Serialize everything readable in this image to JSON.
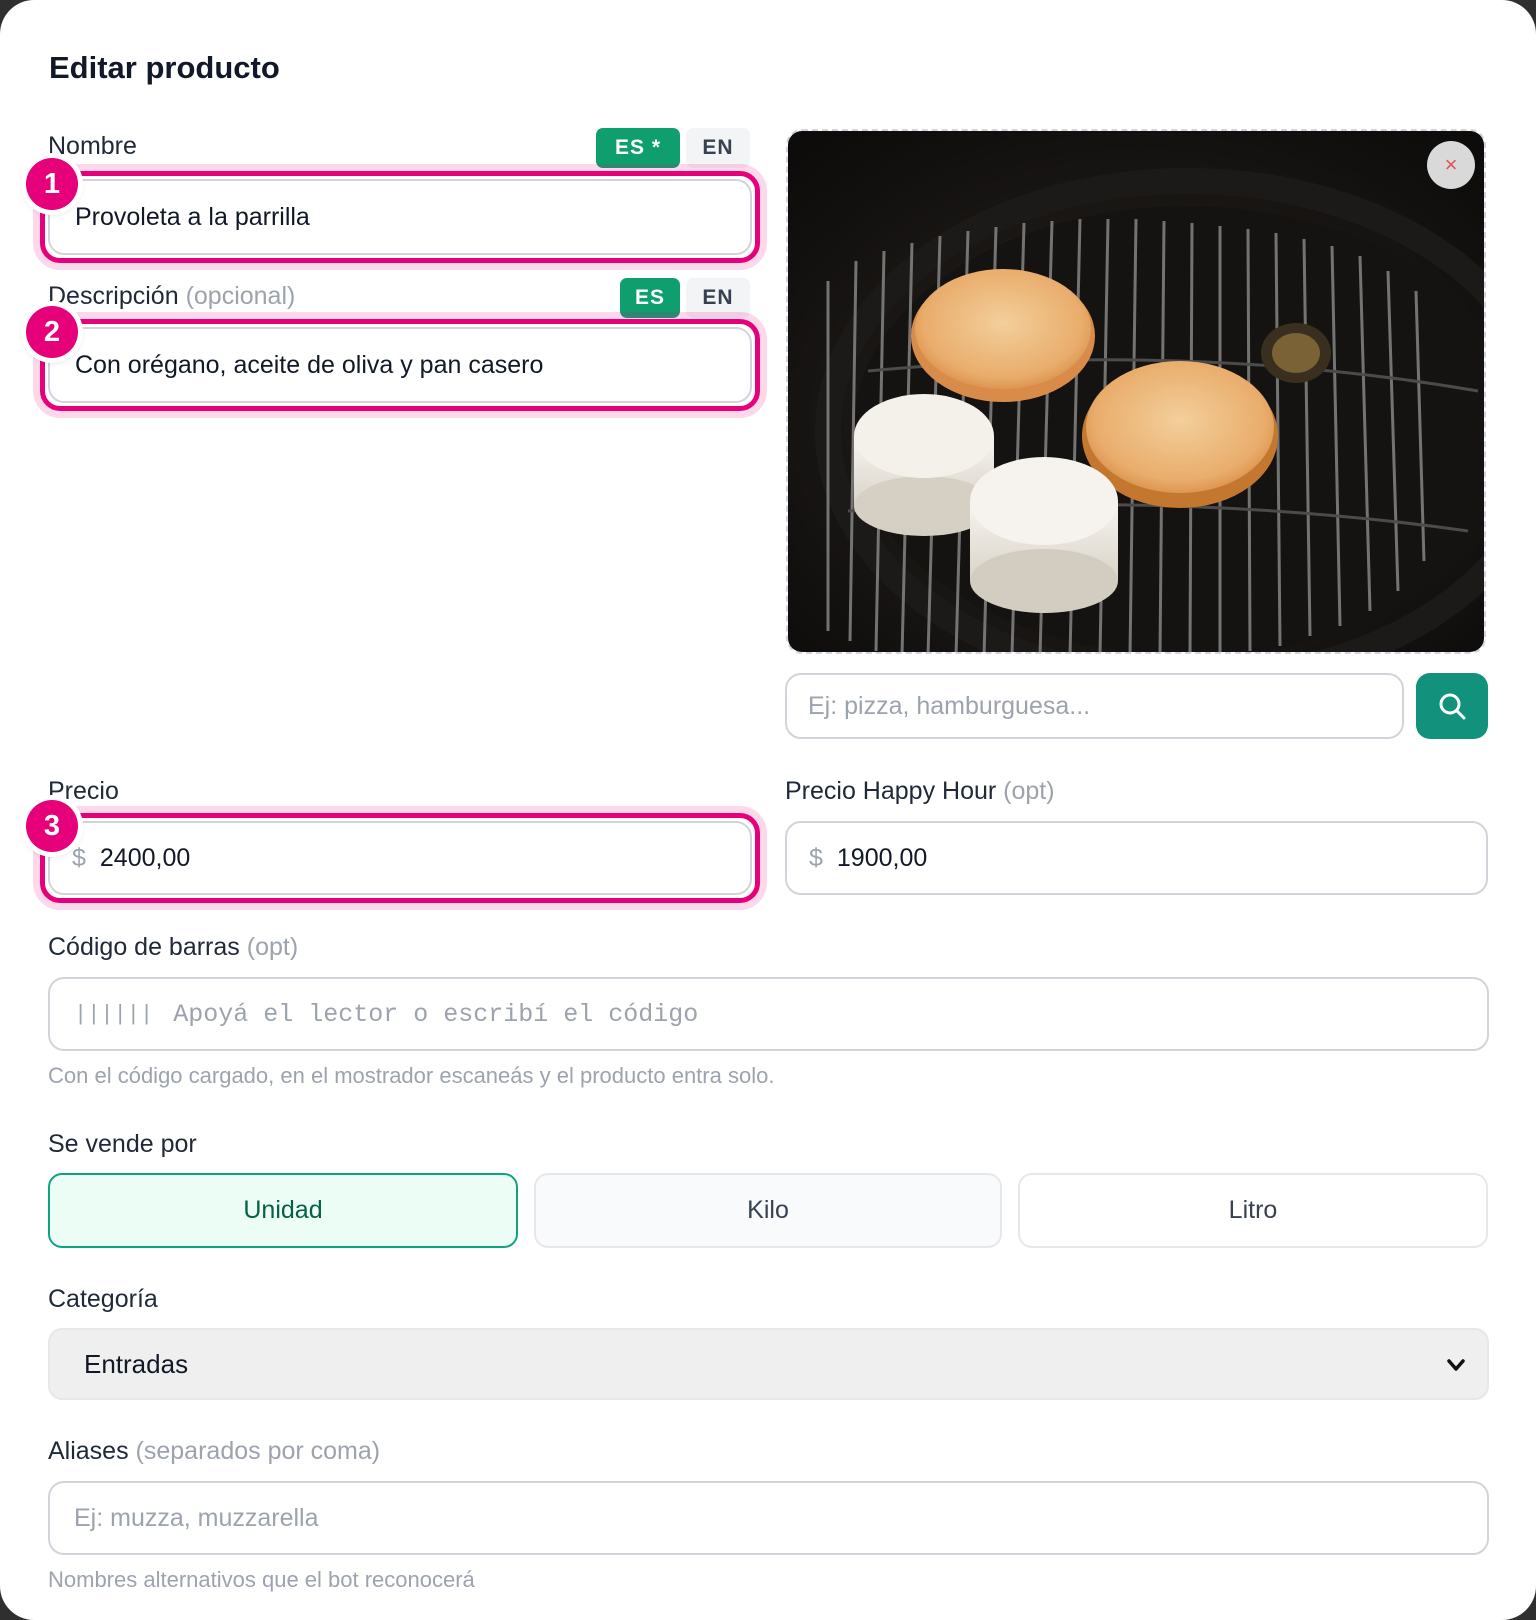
{
  "modal": {
    "title": "Editar producto"
  },
  "nombre": {
    "label": "Nombre",
    "lang_active": "ES *",
    "lang_other": "EN",
    "value": "Provoleta a la parrilla"
  },
  "descripcion": {
    "label": "Descripción",
    "optional": "(opcional)",
    "lang_active": "ES",
    "lang_other": "EN",
    "value": "Con orégano, aceite de oliva y pan casero"
  },
  "image": {
    "close_symbol": "×",
    "search_placeholder": "Ej: pizza, hamburguesa..."
  },
  "precio": {
    "label": "Precio",
    "currency": "$",
    "value": "2400,00"
  },
  "happy_hour": {
    "label": "Precio Happy Hour",
    "optional": "(opt)",
    "currency": "$",
    "value": "1900,00"
  },
  "barcode": {
    "label": "Código de barras",
    "optional": "(opt)",
    "icon": "barcode-icon",
    "icon_glyph": "||||||",
    "placeholder": "Apoyá el lector o escribí el código",
    "hint": "Con el código cargado, en el mostrador escaneás y el producto entra solo."
  },
  "vende_por": {
    "label": "Se vende por",
    "options": [
      "Unidad",
      "Kilo",
      "Litro"
    ],
    "selected": "Unidad"
  },
  "categoria": {
    "label": "Categoría",
    "value": "Entradas"
  },
  "aliases": {
    "label": "Aliases",
    "optional": "(separados por coma)",
    "placeholder": "Ej: muzza, muzzarella",
    "hint": "Nombres alternativos que el bot reconocerá"
  },
  "annotations": [
    "1",
    "2",
    "3"
  ],
  "colors": {
    "accent_green": "#0f9f6e",
    "highlight_pink": "#e6007a",
    "search_teal": "#12917d"
  }
}
